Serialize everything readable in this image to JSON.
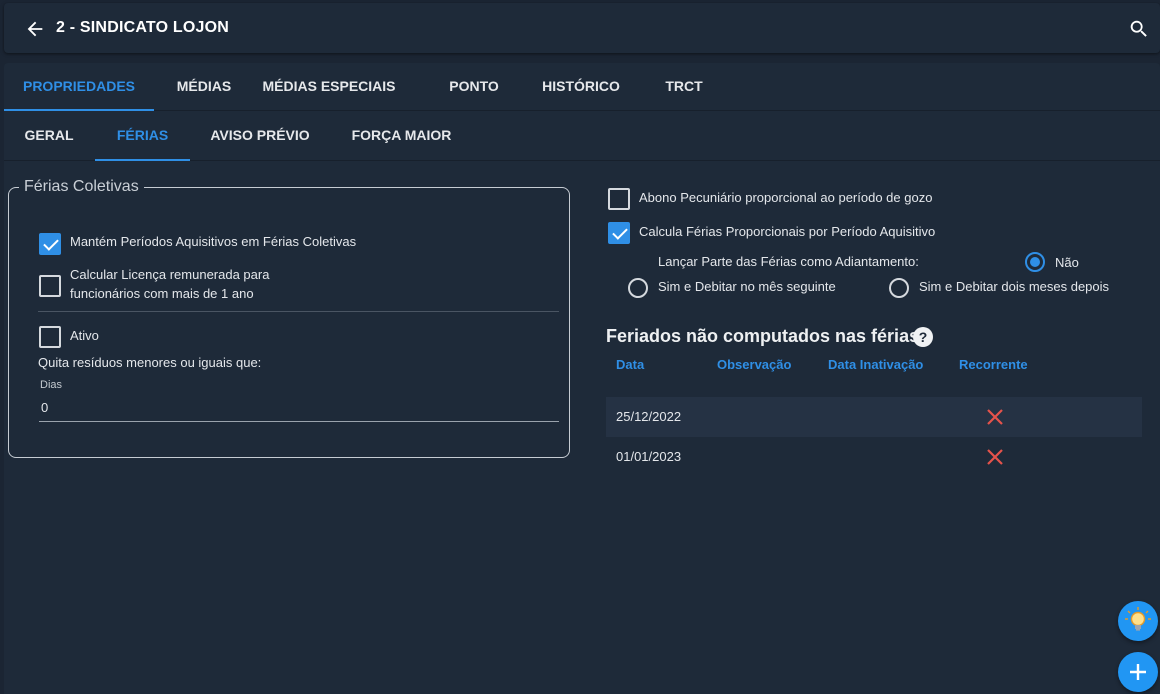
{
  "header": {
    "title": "2 - SINDICATO LOJON",
    "back_icon": "arrow-left-icon",
    "search_icon": "search-icon"
  },
  "tabs": [
    "PROPRIEDADES",
    "MÉDIAS",
    "MÉDIAS ESPECIAIS",
    "PONTO",
    "HISTÓRICO",
    "TRCT"
  ],
  "subtabs": [
    "GERAL",
    "FÉRIAS",
    "AVISO PRÉVIO",
    "FORÇA MAIOR"
  ],
  "ferias_coletivas": {
    "legend": "Férias Coletivas",
    "mantem_periodos": {
      "label": "Mantém Períodos Aquisitivos em Férias Coletivas",
      "checked": true
    },
    "calcular_licenca": {
      "label_line1": "Calcular Licença remunerada para",
      "label_line2": "funcionários com mais de 1 ano",
      "checked": false
    },
    "ativo": {
      "label": "Ativo",
      "checked": false
    },
    "quita_label": "Quita resíduos menores ou iguais que:",
    "dias_label": "Dias",
    "dias_value": "0"
  },
  "options": {
    "abono": {
      "label": "Abono Pecuniário proporcional ao período de gozo",
      "checked": false
    },
    "calcula_ferias": {
      "label": "Calcula Férias Proporcionais por Período Aquisitivo",
      "checked": true
    },
    "adiantamento_label": "Lançar Parte das Férias como Adiantamento:",
    "radio_nao": "Não",
    "radio_mes_seguinte": "Sim e Debitar no mês seguinte",
    "radio_dois_meses": "Sim e Debitar dois meses depois",
    "selected": "Não"
  },
  "feriados": {
    "title": "Feriados não computados nas férias",
    "help_icon": "?",
    "columns": [
      "Data",
      "Observação",
      "Data Inativação",
      "Recorrente"
    ],
    "rows": [
      {
        "data": "25/12/2022",
        "observacao": "",
        "data_inativacao": "",
        "recorrente": false
      },
      {
        "data": "01/01/2023",
        "observacao": "",
        "data_inativacao": "",
        "recorrente": false
      }
    ]
  },
  "fabs": {
    "tips_icon": "lightbulb-icon",
    "add_icon": "plus-icon"
  },
  "colors": {
    "accent": "#2f8fe6",
    "background": "#1b2533",
    "panel": "#1e2a39",
    "danger": "#e5534b"
  }
}
